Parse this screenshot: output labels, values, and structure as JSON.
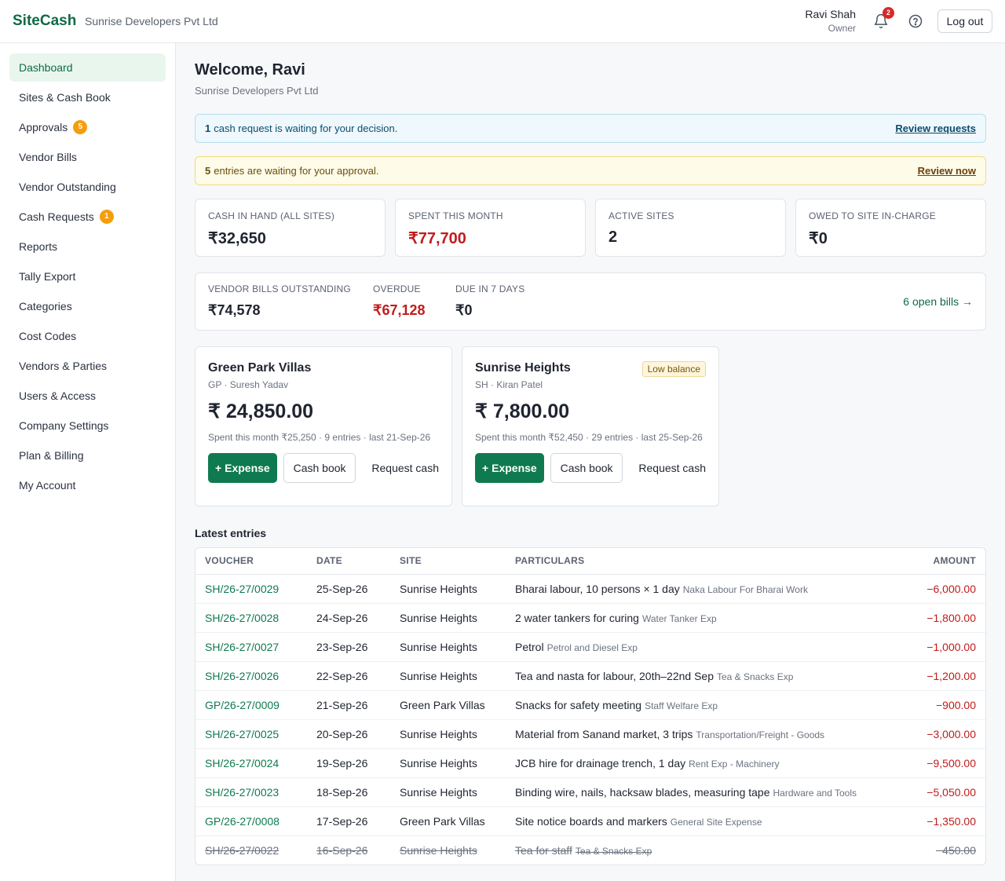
{
  "header": {
    "brand": "SiteCash",
    "company": "Sunrise Developers Pvt Ltd",
    "user_name": "Ravi Shah",
    "user_role": "Owner",
    "notification_count": "2",
    "logout_label": "Log out"
  },
  "sidebar": {
    "items": [
      {
        "label": "Dashboard",
        "badge": "",
        "active": true
      },
      {
        "label": "Sites & Cash Book",
        "badge": ""
      },
      {
        "label": "Approvals",
        "badge": "5"
      },
      {
        "label": "Vendor Bills",
        "badge": ""
      },
      {
        "label": "Vendor Outstanding",
        "badge": ""
      },
      {
        "label": "Cash Requests",
        "badge": "1"
      },
      {
        "label": "Reports",
        "badge": ""
      },
      {
        "label": "Tally Export",
        "badge": ""
      },
      {
        "label": "Categories",
        "badge": ""
      },
      {
        "label": "Cost Codes",
        "badge": ""
      },
      {
        "label": "Vendors & Parties",
        "badge": ""
      },
      {
        "label": "Users & Access",
        "badge": ""
      },
      {
        "label": "Company Settings",
        "badge": ""
      },
      {
        "label": "Plan & Billing",
        "badge": ""
      },
      {
        "label": "My Account",
        "badge": ""
      }
    ]
  },
  "main": {
    "welcome": "Welcome, Ravi",
    "company": "Sunrise Developers Pvt Ltd",
    "banners": {
      "requests_count": "1",
      "requests_text": "cash request is waiting for your decision.",
      "requests_link": "Review requests",
      "approvals_count": "5",
      "approvals_text": "entries are waiting for your approval.",
      "approvals_link": "Review now"
    },
    "stats": [
      {
        "label": "CASH IN HAND (ALL SITES)",
        "value": "₹32,650"
      },
      {
        "label": "SPENT THIS MONTH",
        "value": "₹77,700"
      },
      {
        "label": "ACTIVE SITES",
        "value": "2"
      },
      {
        "label": "OWED TO SITE IN-CHARGE",
        "value": "₹0"
      }
    ],
    "vendor_bills": {
      "outstanding_label": "VENDOR BILLS OUTSTANDING",
      "outstanding_value": "₹74,578",
      "overdue_label": "OVERDUE",
      "overdue_value": "₹67,128",
      "due_label": "DUE IN 7 DAYS",
      "due_value": "₹0",
      "open_link": "6 open bills →"
    },
    "sites": [
      {
        "name": "Green Park Villas",
        "code": "GP · Suresh Yadav",
        "balance": "₹ 24,850.00",
        "meta": "Spent this month ₹25,250 · 9 entries · last 21-Sep-26",
        "badge": "",
        "expense_label": "+ Expense",
        "cashbook_label": "Cash book",
        "request_label": "Request cash"
      },
      {
        "name": "Sunrise Heights",
        "code": "SH · Kiran Patel",
        "balance": "₹ 7,800.00",
        "meta": "Spent this month ₹52,450 · 29 entries · last 25-Sep-26",
        "badge": "Low balance",
        "expense_label": "+ Expense",
        "cashbook_label": "Cash book",
        "request_label": "Request cash"
      }
    ],
    "entries_title": "Latest entries",
    "entries_columns": [
      "VOUCHER",
      "DATE",
      "SITE",
      "PARTICULARS",
      "AMOUNT"
    ],
    "entries": [
      {
        "voucher": "SH/26-27/0029",
        "date": "25-Sep-26",
        "site": "Sunrise Heights",
        "particulars": "Bharai labour, 10 persons × 1 day",
        "category": "Naka Labour For Bharai Work",
        "amount": "−6,000.00",
        "struck": false
      },
      {
        "voucher": "SH/26-27/0028",
        "date": "24-Sep-26",
        "site": "Sunrise Heights",
        "particulars": "2 water tankers for curing",
        "category": "Water Tanker Exp",
        "amount": "−1,800.00",
        "struck": false
      },
      {
        "voucher": "SH/26-27/0027",
        "date": "23-Sep-26",
        "site": "Sunrise Heights",
        "particulars": "Petrol",
        "category": "Petrol and Diesel Exp",
        "amount": "−1,000.00",
        "struck": false
      },
      {
        "voucher": "SH/26-27/0026",
        "date": "22-Sep-26",
        "site": "Sunrise Heights",
        "particulars": "Tea and nasta for labour, 20th–22nd Sep",
        "category": "Tea & Snacks Exp",
        "amount": "−1,200.00",
        "struck": false
      },
      {
        "voucher": "GP/26-27/0009",
        "date": "21-Sep-26",
        "site": "Green Park Villas",
        "particulars": "Snacks for safety meeting",
        "category": "Staff Welfare Exp",
        "amount": "−900.00",
        "struck": false
      },
      {
        "voucher": "SH/26-27/0025",
        "date": "20-Sep-26",
        "site": "Sunrise Heights",
        "particulars": "Material from Sanand market, 3 trips",
        "category": "Transportation/Freight - Goods",
        "amount": "−3,000.00",
        "struck": false
      },
      {
        "voucher": "SH/26-27/0024",
        "date": "19-Sep-26",
        "site": "Sunrise Heights",
        "particulars": "JCB hire for drainage trench, 1 day",
        "category": "Rent Exp - Machinery",
        "amount": "−9,500.00",
        "struck": false
      },
      {
        "voucher": "SH/26-27/0023",
        "date": "18-Sep-26",
        "site": "Sunrise Heights",
        "particulars": "Binding wire, nails, hacksaw blades, measuring tape",
        "category": "Hardware and Tools",
        "amount": "−5,050.00",
        "struck": false
      },
      {
        "voucher": "GP/26-27/0008",
        "date": "17-Sep-26",
        "site": "Green Park Villas",
        "particulars": "Site notice boards and markers",
        "category": "General Site Expense",
        "amount": "−1,350.00",
        "struck": false
      },
      {
        "voucher": "SH/26-27/0022",
        "date": "16-Sep-26",
        "site": "Sunrise Heights",
        "particulars": "Tea for staff",
        "category": "Tea & Snacks Exp",
        "amount": "−450.00",
        "struck": true
      }
    ]
  },
  "colors": {
    "brand": "#0f6b46",
    "primary_button": "#0f7a4f",
    "negative": "#c11c1c",
    "badge": "#f59e0b",
    "alert": "#dc2626"
  }
}
